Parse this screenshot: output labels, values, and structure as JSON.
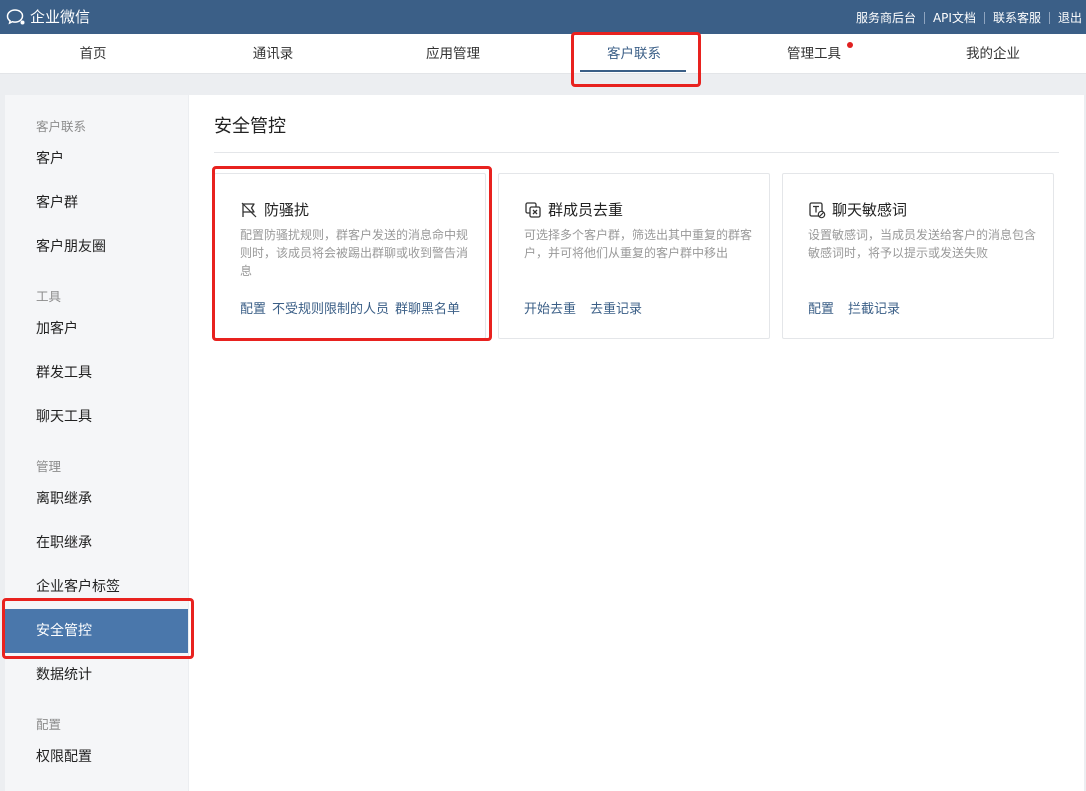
{
  "topbar": {
    "app_name": "企业微信",
    "links": [
      "服务商后台",
      "API文档",
      "联系客服",
      "退出"
    ]
  },
  "nav": {
    "items": [
      "首页",
      "通讯录",
      "应用管理",
      "客户联系",
      "管理工具",
      "我的企业"
    ],
    "active": "客户联系"
  },
  "sidebar": {
    "group_customer": "客户联系",
    "customer": "客户",
    "customer_group": "客户群",
    "moments": "客户朋友圈",
    "group_tools": "工具",
    "add_customer": "加客户",
    "mass_send": "群发工具",
    "chat_tools": "聊天工具",
    "group_manage": "管理",
    "resign_inherit": "离职继承",
    "onjob_inherit": "在职继承",
    "customer_tags": "企业客户标签",
    "security": "安全管控",
    "statistics": "数据统计",
    "group_config": "配置",
    "permission": "权限配置"
  },
  "main": {
    "title": "安全管控",
    "cards": [
      {
        "title": "防骚扰",
        "desc": "配置防骚扰规则，群客户发送的消息命中规则时，该成员将会被踢出群聊或收到警告消息",
        "actions": [
          "配置",
          "不受规则限制的人员",
          "群聊黑名单"
        ]
      },
      {
        "title": "群成员去重",
        "desc": "可选择多个客户群，筛选出其中重复的群客户，并可将他们从重复的客户群中移出",
        "actions": [
          "开始去重",
          "去重记录"
        ]
      },
      {
        "title": "聊天敏感词",
        "desc": "设置敏感词，当成员发送给客户的消息包含敏感词时，将予以提示或发送失败",
        "actions": [
          "配置",
          "拦截记录"
        ]
      }
    ]
  },
  "colors": {
    "topbar": "#3b5f87",
    "accent": "#4a77ab",
    "link": "#3b5f87",
    "highlight": "#e8221f",
    "notify_dot": "#e02020"
  }
}
